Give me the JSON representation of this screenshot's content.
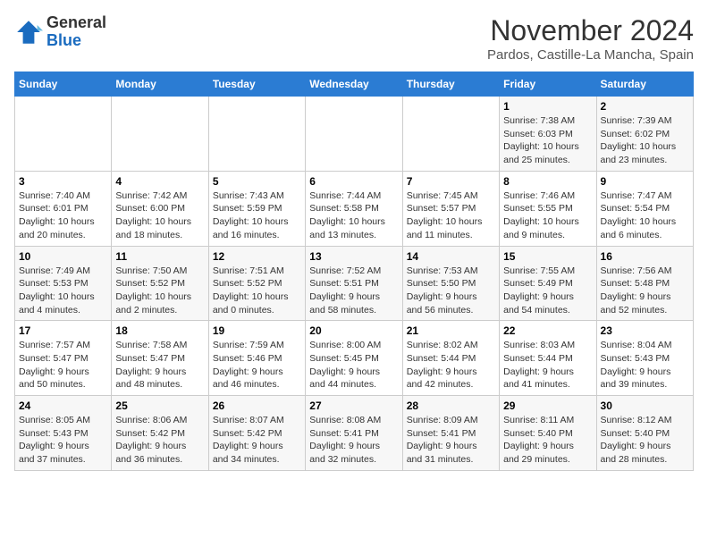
{
  "header": {
    "logo": {
      "general": "General",
      "blue": "Blue"
    },
    "title": "November 2024",
    "location": "Pardos, Castille-La Mancha, Spain"
  },
  "calendar": {
    "weekdays": [
      "Sunday",
      "Monday",
      "Tuesday",
      "Wednesday",
      "Thursday",
      "Friday",
      "Saturday"
    ],
    "weeks": [
      [
        {
          "day": "",
          "info": ""
        },
        {
          "day": "",
          "info": ""
        },
        {
          "day": "",
          "info": ""
        },
        {
          "day": "",
          "info": ""
        },
        {
          "day": "",
          "info": ""
        },
        {
          "day": "1",
          "info": "Sunrise: 7:38 AM\nSunset: 6:03 PM\nDaylight: 10 hours\nand 25 minutes."
        },
        {
          "day": "2",
          "info": "Sunrise: 7:39 AM\nSunset: 6:02 PM\nDaylight: 10 hours\nand 23 minutes."
        }
      ],
      [
        {
          "day": "3",
          "info": "Sunrise: 7:40 AM\nSunset: 6:01 PM\nDaylight: 10 hours\nand 20 minutes."
        },
        {
          "day": "4",
          "info": "Sunrise: 7:42 AM\nSunset: 6:00 PM\nDaylight: 10 hours\nand 18 minutes."
        },
        {
          "day": "5",
          "info": "Sunrise: 7:43 AM\nSunset: 5:59 PM\nDaylight: 10 hours\nand 16 minutes."
        },
        {
          "day": "6",
          "info": "Sunrise: 7:44 AM\nSunset: 5:58 PM\nDaylight: 10 hours\nand 13 minutes."
        },
        {
          "day": "7",
          "info": "Sunrise: 7:45 AM\nSunset: 5:57 PM\nDaylight: 10 hours\nand 11 minutes."
        },
        {
          "day": "8",
          "info": "Sunrise: 7:46 AM\nSunset: 5:55 PM\nDaylight: 10 hours\nand 9 minutes."
        },
        {
          "day": "9",
          "info": "Sunrise: 7:47 AM\nSunset: 5:54 PM\nDaylight: 10 hours\nand 6 minutes."
        }
      ],
      [
        {
          "day": "10",
          "info": "Sunrise: 7:49 AM\nSunset: 5:53 PM\nDaylight: 10 hours\nand 4 minutes."
        },
        {
          "day": "11",
          "info": "Sunrise: 7:50 AM\nSunset: 5:52 PM\nDaylight: 10 hours\nand 2 minutes."
        },
        {
          "day": "12",
          "info": "Sunrise: 7:51 AM\nSunset: 5:52 PM\nDaylight: 10 hours\nand 0 minutes."
        },
        {
          "day": "13",
          "info": "Sunrise: 7:52 AM\nSunset: 5:51 PM\nDaylight: 9 hours\nand 58 minutes."
        },
        {
          "day": "14",
          "info": "Sunrise: 7:53 AM\nSunset: 5:50 PM\nDaylight: 9 hours\nand 56 minutes."
        },
        {
          "day": "15",
          "info": "Sunrise: 7:55 AM\nSunset: 5:49 PM\nDaylight: 9 hours\nand 54 minutes."
        },
        {
          "day": "16",
          "info": "Sunrise: 7:56 AM\nSunset: 5:48 PM\nDaylight: 9 hours\nand 52 minutes."
        }
      ],
      [
        {
          "day": "17",
          "info": "Sunrise: 7:57 AM\nSunset: 5:47 PM\nDaylight: 9 hours\nand 50 minutes."
        },
        {
          "day": "18",
          "info": "Sunrise: 7:58 AM\nSunset: 5:47 PM\nDaylight: 9 hours\nand 48 minutes."
        },
        {
          "day": "19",
          "info": "Sunrise: 7:59 AM\nSunset: 5:46 PM\nDaylight: 9 hours\nand 46 minutes."
        },
        {
          "day": "20",
          "info": "Sunrise: 8:00 AM\nSunset: 5:45 PM\nDaylight: 9 hours\nand 44 minutes."
        },
        {
          "day": "21",
          "info": "Sunrise: 8:02 AM\nSunset: 5:44 PM\nDaylight: 9 hours\nand 42 minutes."
        },
        {
          "day": "22",
          "info": "Sunrise: 8:03 AM\nSunset: 5:44 PM\nDaylight: 9 hours\nand 41 minutes."
        },
        {
          "day": "23",
          "info": "Sunrise: 8:04 AM\nSunset: 5:43 PM\nDaylight: 9 hours\nand 39 minutes."
        }
      ],
      [
        {
          "day": "24",
          "info": "Sunrise: 8:05 AM\nSunset: 5:43 PM\nDaylight: 9 hours\nand 37 minutes."
        },
        {
          "day": "25",
          "info": "Sunrise: 8:06 AM\nSunset: 5:42 PM\nDaylight: 9 hours\nand 36 minutes."
        },
        {
          "day": "26",
          "info": "Sunrise: 8:07 AM\nSunset: 5:42 PM\nDaylight: 9 hours\nand 34 minutes."
        },
        {
          "day": "27",
          "info": "Sunrise: 8:08 AM\nSunset: 5:41 PM\nDaylight: 9 hours\nand 32 minutes."
        },
        {
          "day": "28",
          "info": "Sunrise: 8:09 AM\nSunset: 5:41 PM\nDaylight: 9 hours\nand 31 minutes."
        },
        {
          "day": "29",
          "info": "Sunrise: 8:11 AM\nSunset: 5:40 PM\nDaylight: 9 hours\nand 29 minutes."
        },
        {
          "day": "30",
          "info": "Sunrise: 8:12 AM\nSunset: 5:40 PM\nDaylight: 9 hours\nand 28 minutes."
        }
      ]
    ]
  }
}
